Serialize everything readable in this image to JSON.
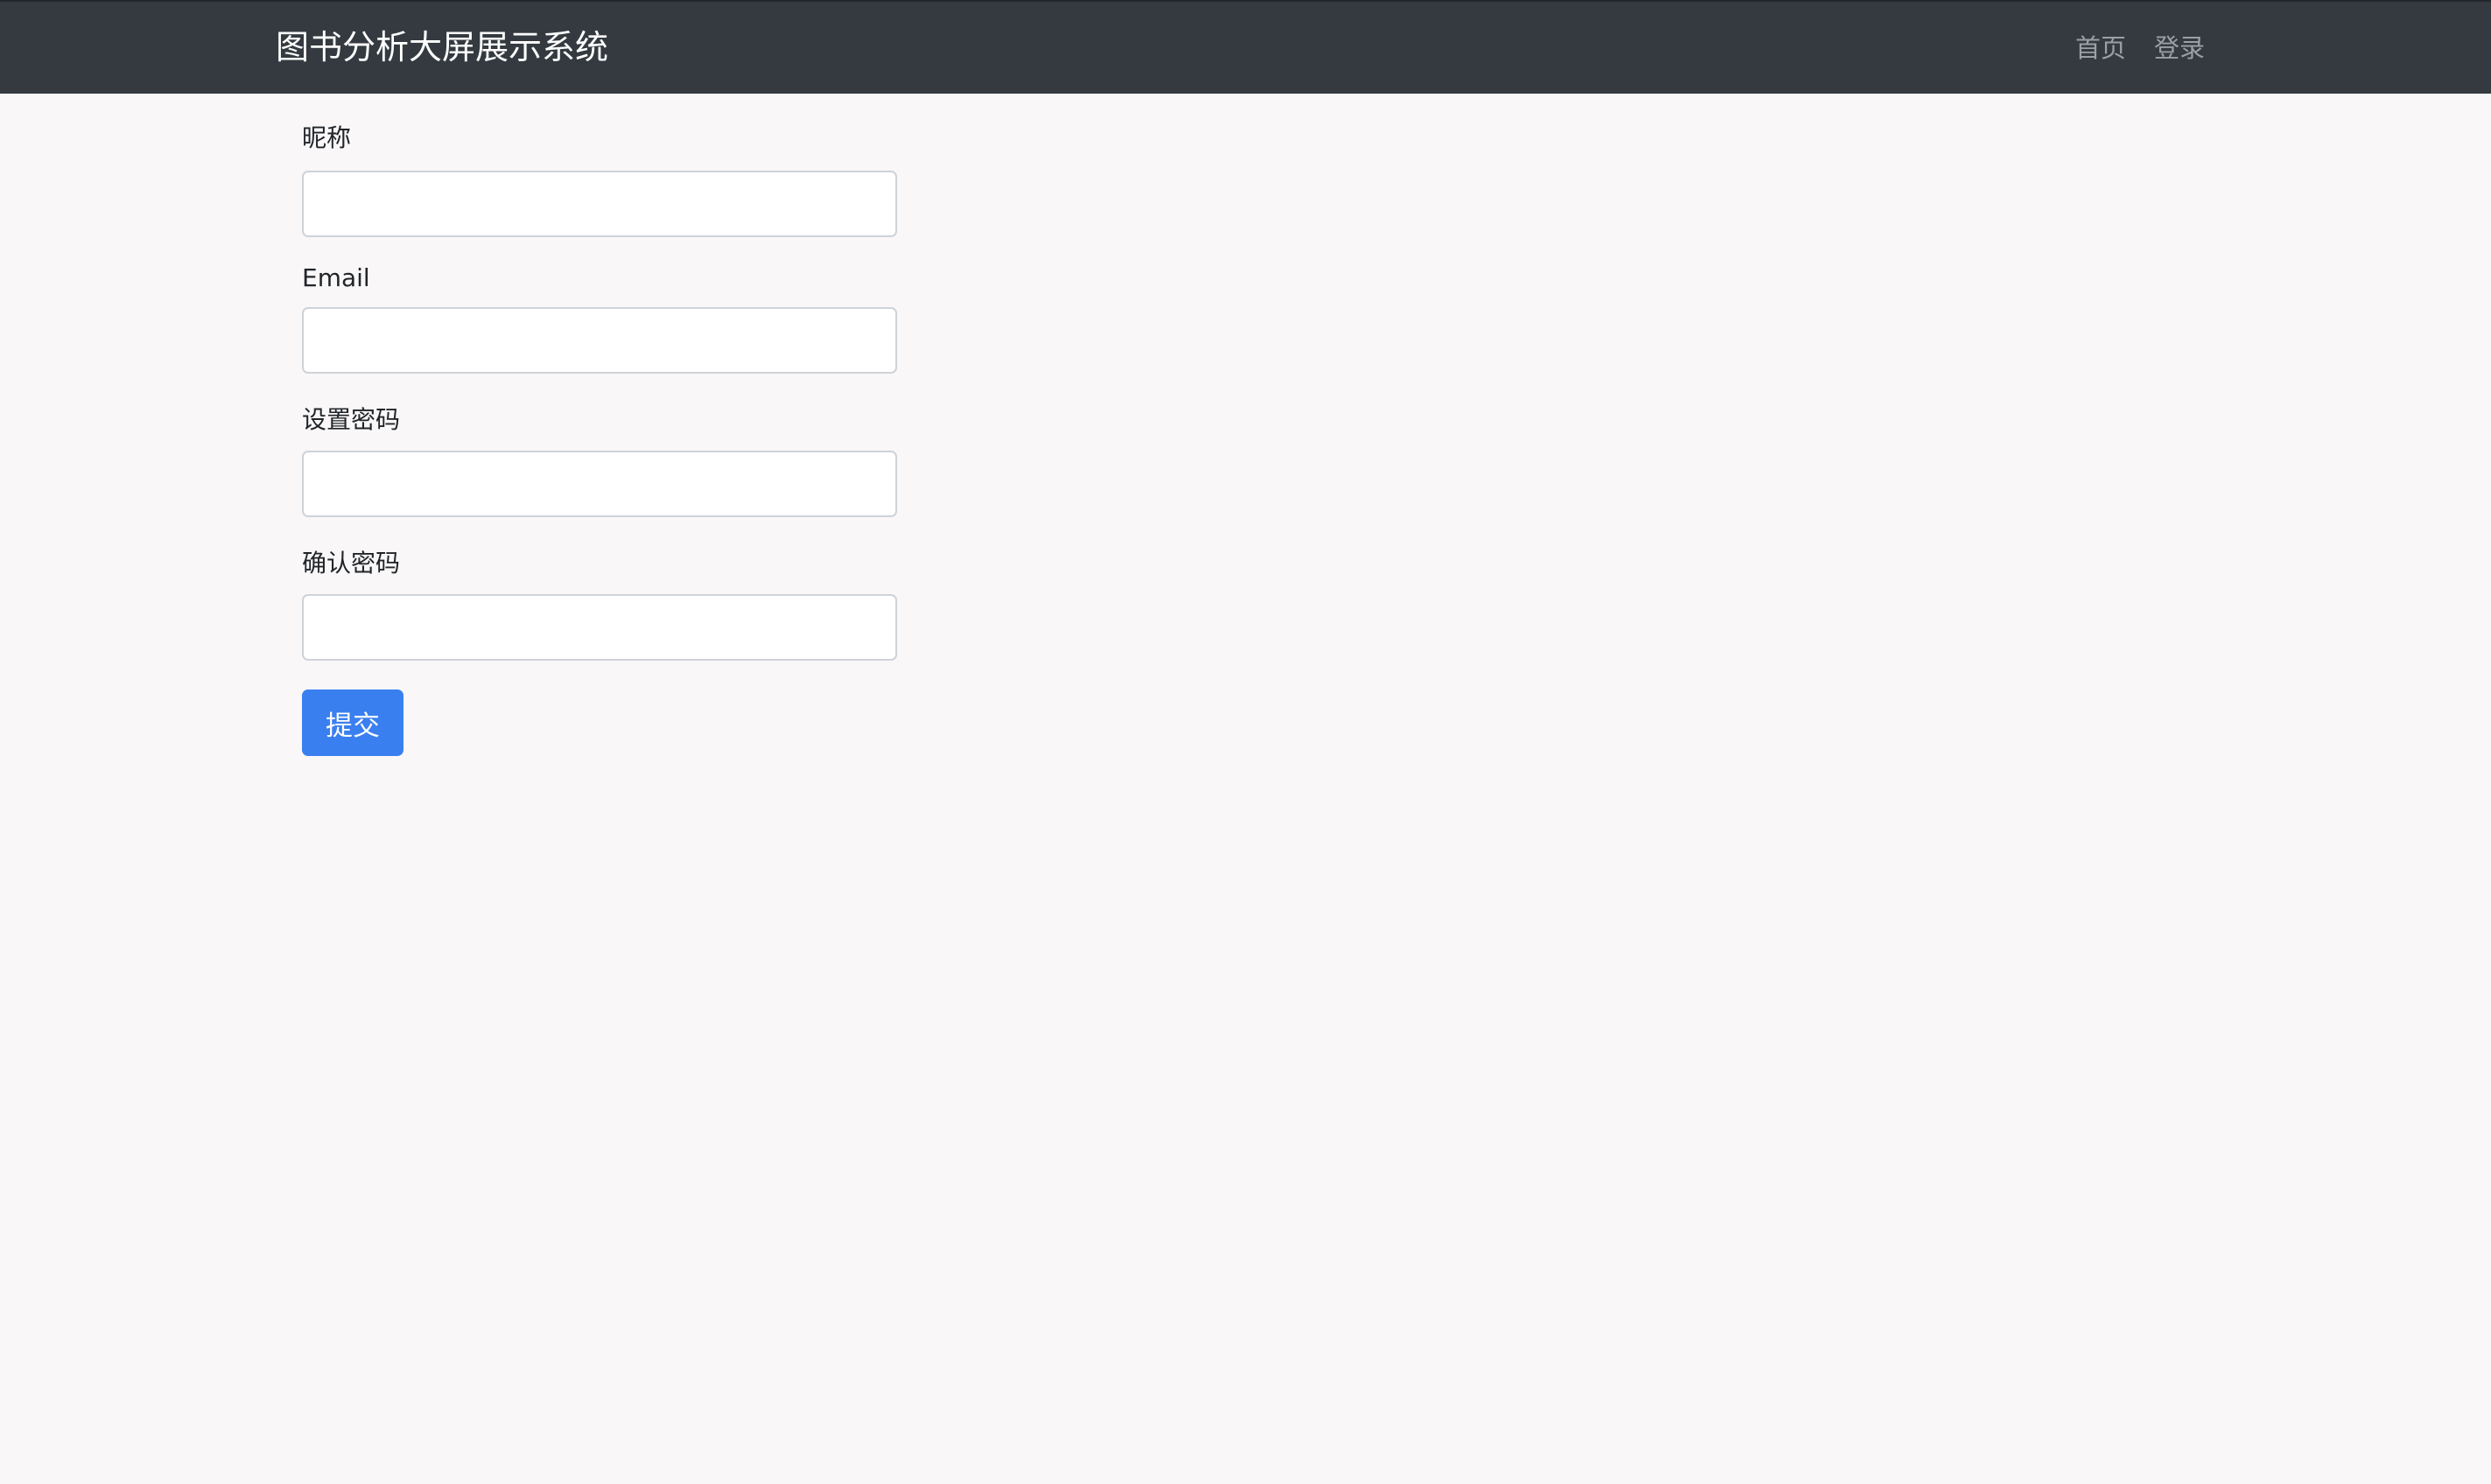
{
  "navbar": {
    "brand": "图书分析大屏展示系统",
    "links": [
      {
        "label": "首页"
      },
      {
        "label": "登录"
      }
    ]
  },
  "form": {
    "fields": [
      {
        "label": "昵称",
        "value": "",
        "type": "text"
      },
      {
        "label": "Email",
        "value": "",
        "type": "email"
      },
      {
        "label": "设置密码",
        "value": "",
        "type": "password"
      },
      {
        "label": "确认密码",
        "value": "",
        "type": "password"
      }
    ],
    "submit_label": "提交"
  },
  "colors": {
    "navbar_bg": "#343a40",
    "page_bg": "#f9f7f8",
    "primary": "#3a7ff0"
  }
}
